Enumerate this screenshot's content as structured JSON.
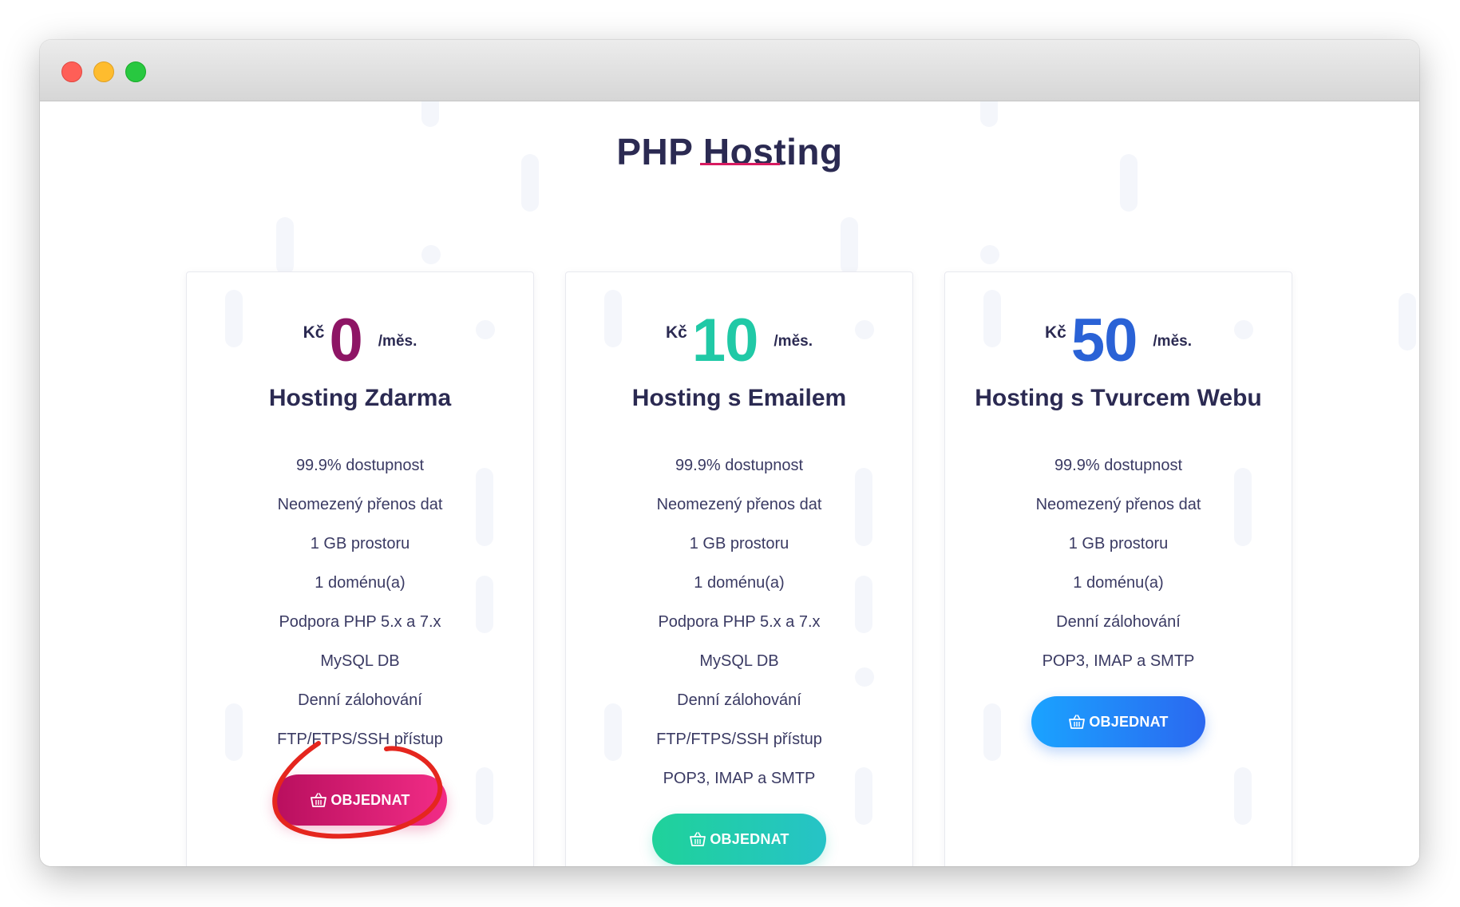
{
  "page": {
    "title": "PHP Hosting",
    "accent_color": "#d81b60"
  },
  "plans": [
    {
      "currency": "Kč",
      "price": "0",
      "period": "/měs.",
      "name": "Hosting Zdarma",
      "price_color": "#8e1565",
      "features": [
        "99.9% dostupnost",
        "Neomezený přenos dat",
        "1 GB prostoru",
        "1 doménu(a)",
        "Podpora PHP 5.x a 7.x",
        "MySQL DB",
        "Denní zálohování",
        "FTP/FTPS/SSH přístup"
      ],
      "button_label": "OBJEDNAT",
      "button_icon": "basket-icon",
      "button_color": "#d81b60",
      "annotation": "red-circle-highlight"
    },
    {
      "currency": "Kč",
      "price": "10",
      "period": "/měs.",
      "name": "Hosting s Emailem",
      "price_color": "#20c9a6",
      "features": [
        "99.9% dostupnost",
        "Neomezený přenos dat",
        "1 GB prostoru",
        "1 doménu(a)",
        "Podpora PHP 5.x a 7.x",
        "MySQL DB",
        "Denní zálohování",
        "FTP/FTPS/SSH přístup",
        "POP3, IMAP a SMTP"
      ],
      "button_label": "OBJEDNAT",
      "button_icon": "basket-icon",
      "button_color": "#22ccb0"
    },
    {
      "currency": "Kč",
      "price": "50",
      "period": "/měs.",
      "name": "Hosting s Tvurcem Webu",
      "price_color": "#2a62d6",
      "features": [
        "99.9% dostupnost",
        "Neomezený přenos dat",
        "1 GB prostoru",
        "1 doménu(a)",
        "Denní zálohování",
        "POP3, IMAP a SMTP"
      ],
      "button_label": "OBJEDNAT",
      "button_icon": "basket-icon",
      "button_color": "#1e88f5"
    }
  ]
}
